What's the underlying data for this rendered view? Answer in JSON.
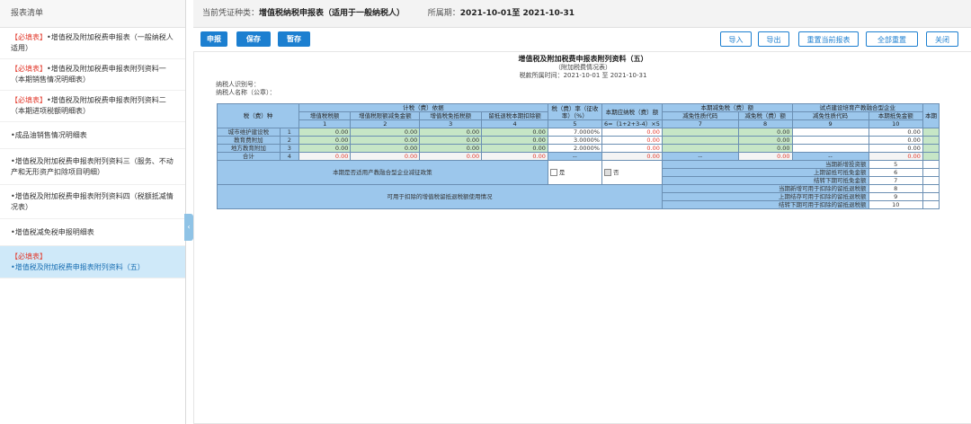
{
  "sidebar": {
    "title": "报表清单",
    "items": [
      {
        "req": "【必填表】",
        "text": "•增值税及附加税费申报表（一般纳税人适用）"
      },
      {
        "req": "【必填表】",
        "text": "•增值税及附加税费申报表附列资料一（本期销售情况明细表）"
      },
      {
        "req": "【必填表】",
        "text": "•增值税及附加税费申报表附列资料二（本期进项税额明细表）"
      },
      {
        "req": "",
        "text": "•成品油销售情况明细表"
      },
      {
        "req": "",
        "text": "•增值税及附加税费申报表附列资料三（服务、不动产和无形资产扣除项目明细）"
      },
      {
        "req": "",
        "text": "•增值税及附加税费申报表附列资料四（税额抵减情况表）"
      },
      {
        "req": "",
        "text": "•增值税减免税申报明细表"
      },
      {
        "req": "【必填表】",
        "text": "•增值税及附加税费申报表附列资料（五）"
      }
    ],
    "collapse_glyph": "‹"
  },
  "topbar": {
    "type_label": "当前凭证种类：",
    "type_value": "增值税纳税申报表（适用于一般纳税人）",
    "period_label": "所属期：",
    "period_value": "2021-10-01至 2021-10-31"
  },
  "toolbar": {
    "declare": "申报",
    "save": "保存",
    "temp_save": "暂存",
    "import": "导入",
    "export": "导出",
    "reset_current": "重置当前报表",
    "reset_all": "全部重置",
    "close": "关闭"
  },
  "form": {
    "title": "增值税及附加税费申报表附列资料（五）",
    "subtitle": "（附加税费情况表）",
    "period": "税款所属时间：2021-10-01 至 2021-10-31",
    "taxpayer_id_label": "纳税人识别号：",
    "taxpayer_name_label": "纳税人名称（公章）："
  },
  "table": {
    "h_tax_type": "税（费）种",
    "h_basis": "计税（费）依据",
    "h_vat": "增值税税额",
    "h_vat_exempt": "增值税限额减免金额",
    "h_vat_free": "增值税免抵税额",
    "h_refund": "留抵退税本期扣除额",
    "h_rate": "税（费）率（征收率）（%）",
    "h_payable": "本期应纳税（费）额",
    "h_reduction": "本期减免税（费）额",
    "h_red_code": "减免性质代码",
    "h_red_amount": "减免税（费）额",
    "h_pilot": "试点建设培育产教融合型企业",
    "h_pilot_code": "减免性质代码",
    "h_pilot_amount": "本期抵免金额",
    "h_more": "本期",
    "c1": "1",
    "c2": "2",
    "c3": "3",
    "c4": "4",
    "c5": "5",
    "c6": "6=（1+2+3-4）×5",
    "c7": "7",
    "c8": "8",
    "c9": "9",
    "c10": "10",
    "rows": [
      {
        "name": "城市维护建设税",
        "no": "1",
        "v1": "0.00",
        "v2": "0.00",
        "v3": "0.00",
        "v4": "0.00",
        "rate": "7.0000%",
        "pay": "0.00",
        "red": "0.00",
        "pilot": "0.00"
      },
      {
        "name": "教育费附加",
        "no": "2",
        "v1": "0.00",
        "v2": "0.00",
        "v3": "0.00",
        "v4": "0.00",
        "rate": "3.0000%",
        "pay": "0.00",
        "red": "0.00",
        "pilot": "0.00"
      },
      {
        "name": "地方教育附加",
        "no": "3",
        "v1": "0.00",
        "v2": "0.00",
        "v3": "0.00",
        "v4": "0.00",
        "rate": "2.0000%",
        "pay": "0.00",
        "red": "0.00",
        "pilot": "0.00"
      }
    ],
    "total": {
      "name": "合计",
      "no": "4",
      "v1": "0.00",
      "v2": "0.00",
      "v3": "0.00",
      "v4": "0.00",
      "rate": "--",
      "pay": "0.00",
      "code": "--",
      "red": "0.00",
      "pcode": "--",
      "pilot": "0.00"
    },
    "policy_q": "本期是否适用产教融合型企业减征政策",
    "yes": "是",
    "no": "否",
    "refund_q": "可用于扣除的增值税留抵退税额使用情况",
    "lines": [
      {
        "label": "当期新增投资额",
        "no": "5"
      },
      {
        "label": "上期留抵可抵免金额",
        "no": "6"
      },
      {
        "label": "结转下期可抵免金额",
        "no": "7"
      },
      {
        "label": "当期新增可用于扣除的留抵退税额",
        "no": "8"
      },
      {
        "label": "上期结存可用于扣除的留抵退税额",
        "no": "9"
      },
      {
        "label": "结转下期可用于扣除的留抵退税额",
        "no": "10"
      }
    ]
  }
}
